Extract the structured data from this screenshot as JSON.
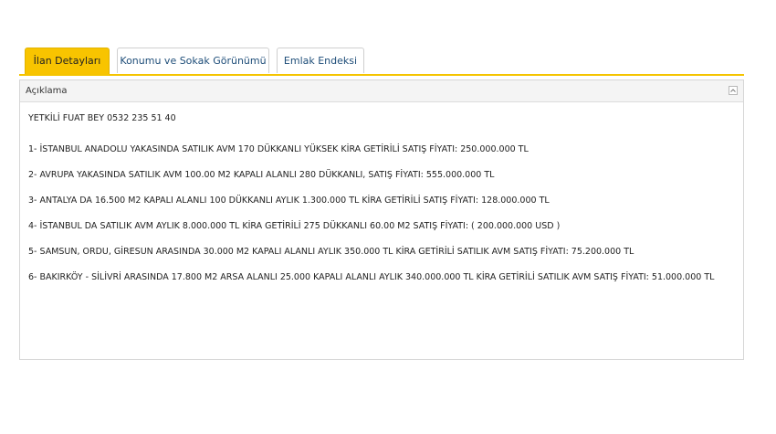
{
  "tabs": [
    {
      "label": "İlan Detayları",
      "active": true
    },
    {
      "label": "Konumu ve Sokak Görünümü",
      "active": false
    },
    {
      "label": "Emlak Endeksi",
      "active": false
    }
  ],
  "panel": {
    "title": "Açıklama",
    "collapse_icon": "collapse-icon",
    "contact": "YETKİLİ FUAT BEY 0532 235 51 40",
    "items": [
      "1- İSTANBUL ANADOLU YAKASINDA SATILIK AVM 170 DÜKKANLI YÜKSEK KİRA GETİRİLİ SATIŞ FİYATI: 250.000.000 TL",
      "2- AVRUPA YAKASINDA SATILIK AVM 100.00 M2 KAPALI ALANLI 280 DÜKKANLI, SATIŞ FİYATI: 555.000.000 TL",
      "3- ANTALYA DA 16.500 M2 KAPALI ALANLI 100 DÜKKANLI AYLIK 1.300.000 TL KİRA GETİRİLİ SATIŞ FİYATI: 128.000.000 TL",
      "4- İSTANBUL DA SATILIK AVM AYLIK 8.000.000 TL KİRA GETİRİLİ 275 DÜKKANLI 60.00 M2 SATIŞ FİYATI: ( 200.000.000 USD )",
      "5- SAMSUN, ORDU, GİRESUN ARASINDA 30.000 M2 KAPALI ALANLI AYLIK 350.000 TL KİRA GETİRİLİ SATILIK AVM SATIŞ FİYATI: 75.200.000 TL",
      "6- BAKIRKÖY - SİLİVRİ ARASINDA 17.800 M2 ARSA ALANLI 25.000 KAPALI ALANLI AYLIK 340.000.000 TL KİRA GETİRİLİ SATILIK AVM SATIŞ FİYATI: 51.000.000 TL"
    ]
  },
  "colors": {
    "accent": "#f8c400",
    "tab_text": "#1f4e79"
  }
}
